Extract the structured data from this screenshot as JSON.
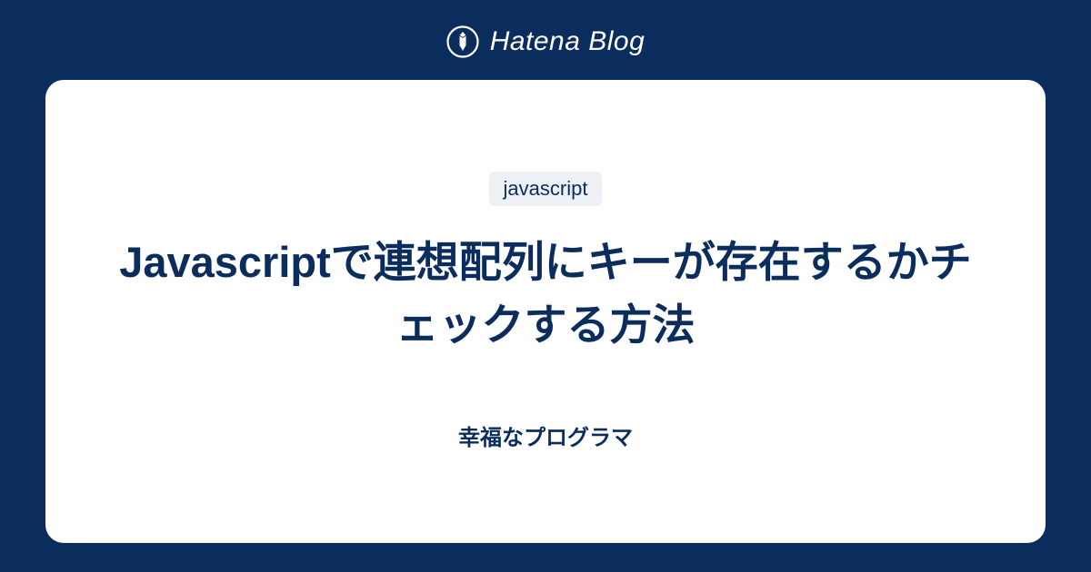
{
  "header": {
    "brand": "Hatena Blog"
  },
  "card": {
    "tag": "javascript",
    "title": "Javascriptで連想配列にキーが存在するかチェックする方法",
    "subtitle": "幸福なプログラマ"
  }
}
